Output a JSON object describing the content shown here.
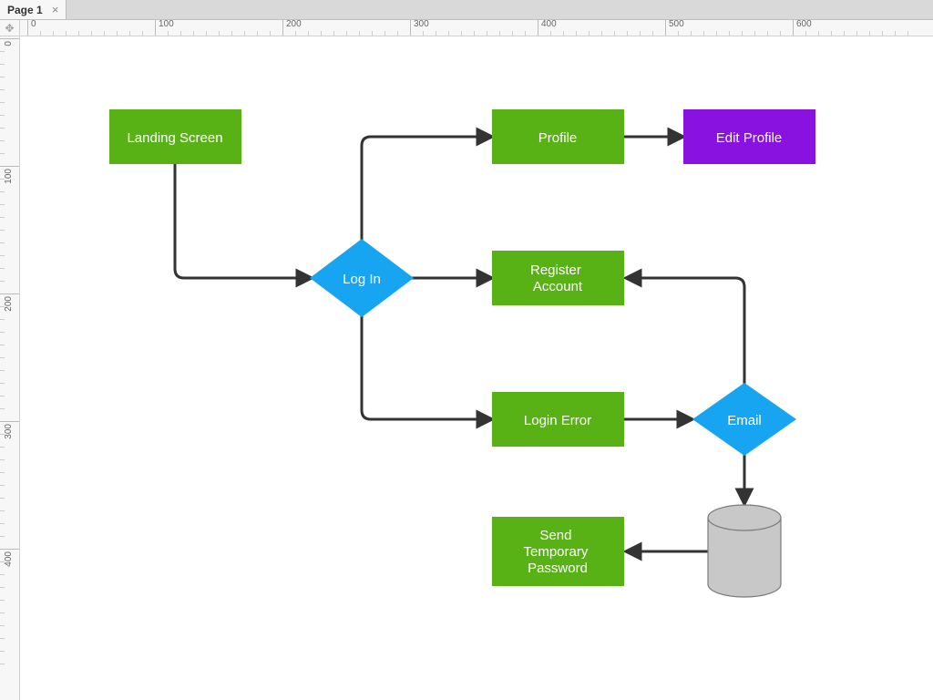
{
  "tabs": {
    "page1": "Page 1"
  },
  "ruler": {
    "h_labels": [
      "0",
      "100",
      "200",
      "300",
      "400",
      "500",
      "600"
    ],
    "v_labels": [
      "0",
      "100",
      "200",
      "300",
      "400"
    ]
  },
  "diagram": {
    "nodes": {
      "landing": {
        "label": "Landing Screen",
        "type": "process",
        "color": "green"
      },
      "login": {
        "label": "Log In",
        "type": "decision",
        "color": "blue"
      },
      "profile": {
        "label": "Profile",
        "type": "process",
        "color": "green"
      },
      "edit": {
        "label": "Edit Profile",
        "type": "process",
        "color": "purple"
      },
      "register": {
        "label": "Register Account",
        "type": "process",
        "color": "green"
      },
      "loginerr": {
        "label": "Login Error",
        "type": "process",
        "color": "green"
      },
      "email": {
        "label": "Email",
        "type": "decision",
        "color": "blue"
      },
      "sendtemp": {
        "label": "Send Temporary Password",
        "type": "process",
        "color": "green"
      },
      "db": {
        "label": "",
        "type": "datastore",
        "color": "grey"
      }
    },
    "edges": [
      {
        "from": "landing",
        "to": "login"
      },
      {
        "from": "login",
        "to": "profile"
      },
      {
        "from": "login",
        "to": "register"
      },
      {
        "from": "login",
        "to": "loginerr"
      },
      {
        "from": "profile",
        "to": "edit"
      },
      {
        "from": "loginerr",
        "to": "email"
      },
      {
        "from": "email",
        "to": "register"
      },
      {
        "from": "email",
        "to": "db"
      },
      {
        "from": "db",
        "to": "sendtemp"
      }
    ]
  }
}
